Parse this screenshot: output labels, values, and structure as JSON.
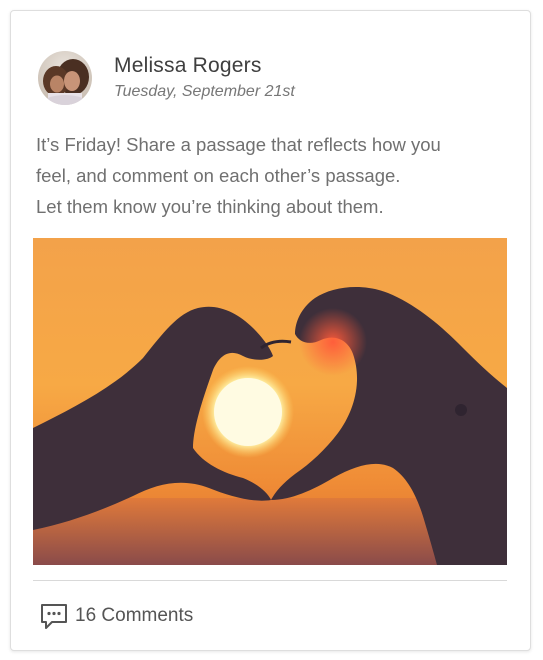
{
  "post": {
    "author": "Melissa Rogers",
    "date": "Tuesday, September 21st",
    "lines": [
      "It’s Friday!  Share a passage that reflects how you",
      "feel, and comment on each other’s passage.",
      "Let them know you’re thinking about them."
    ],
    "comments_label": "16 Comments"
  },
  "icons": {
    "comments": "comment-icon"
  },
  "colors": {
    "text_primary": "#3f3f3f",
    "text_secondary": "#707070",
    "border": "#dedede"
  }
}
